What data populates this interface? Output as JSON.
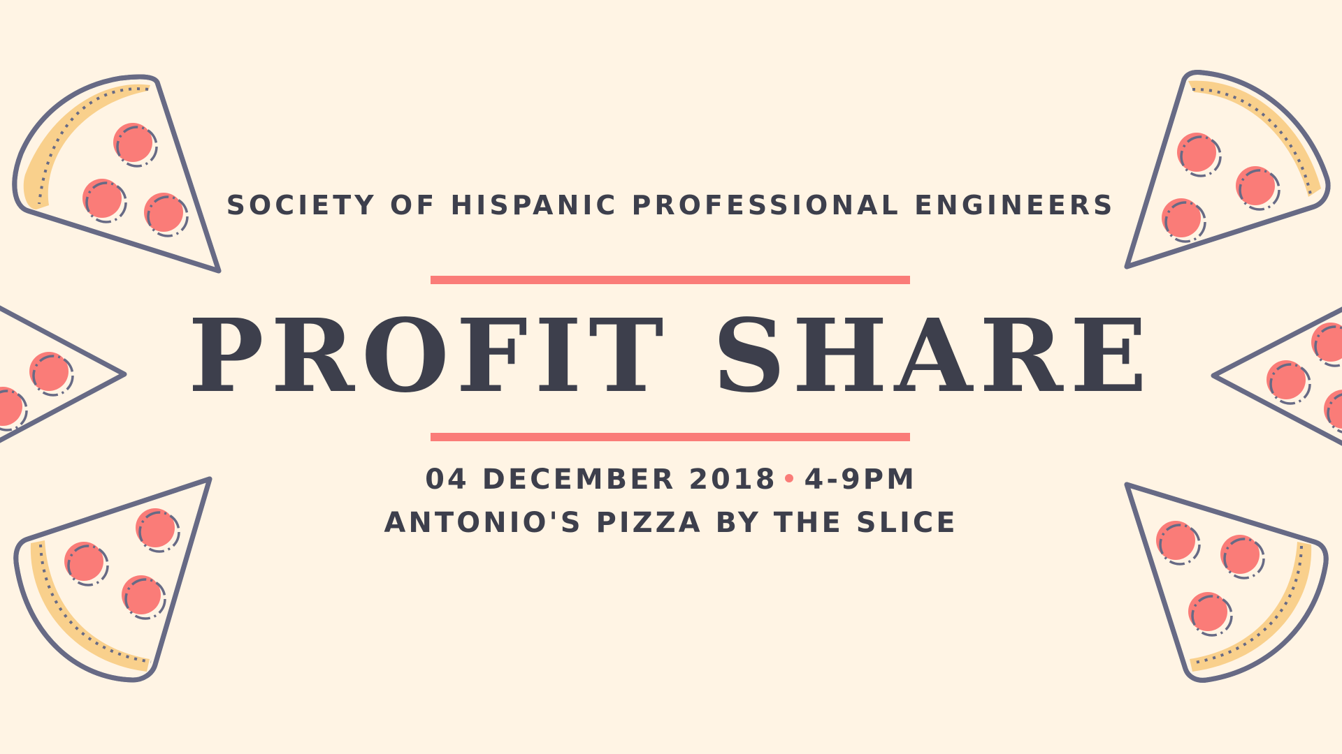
{
  "poster": {
    "organization": "SOCIETY OF HISPANIC PROFESSIONAL ENGINEERS",
    "title": "PROFIT SHARE",
    "date": "04 DECEMBER 2018",
    "time": "4-9PM",
    "venue": "ANTONIO'S PIZZA BY THE SLICE"
  },
  "colors": {
    "background": "#fff4e4",
    "text": "#3d3f4c",
    "accent": "#fa7c78",
    "crust": "#f9d08c",
    "outline": "#676a85"
  },
  "decorations": {
    "icon": "pizza-slice-icon"
  }
}
